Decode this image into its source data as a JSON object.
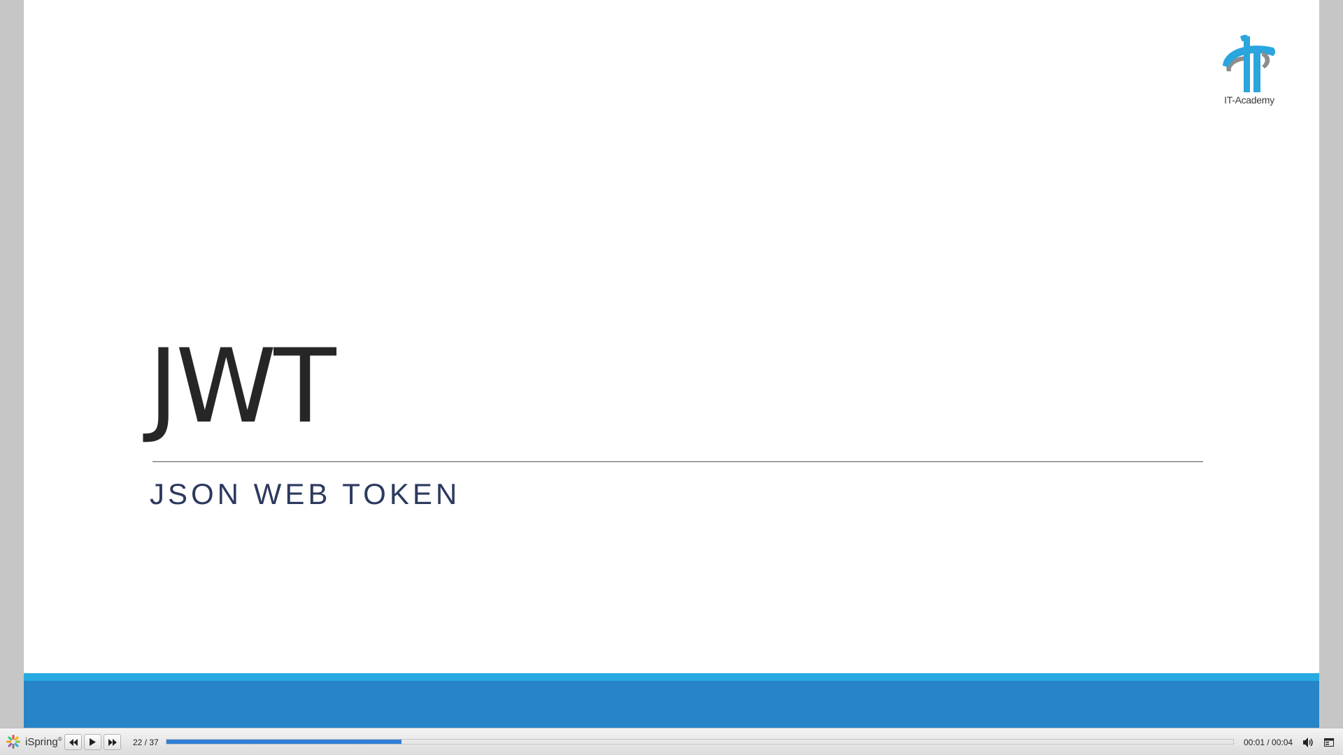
{
  "slide": {
    "title": "JWT",
    "subtitle": "JSON WEB TOKEN",
    "logo_text": "IT-Academy"
  },
  "player": {
    "brand": "iSpring",
    "brand_mark": "®",
    "slide_counter": "22 / 37",
    "progress_fraction": 0.22,
    "time_display": "00:01 / 00:04",
    "icons": {
      "previous": "rewind-icon",
      "play": "play-icon",
      "next": "fast-forward-icon",
      "volume": "speaker-icon",
      "layout": "layout-toggle-icon"
    }
  },
  "colors": {
    "band_light": "#27a9e1",
    "band_dark": "#2684c7",
    "progress": "#2f7fd6",
    "logo": "#2aa5de"
  }
}
